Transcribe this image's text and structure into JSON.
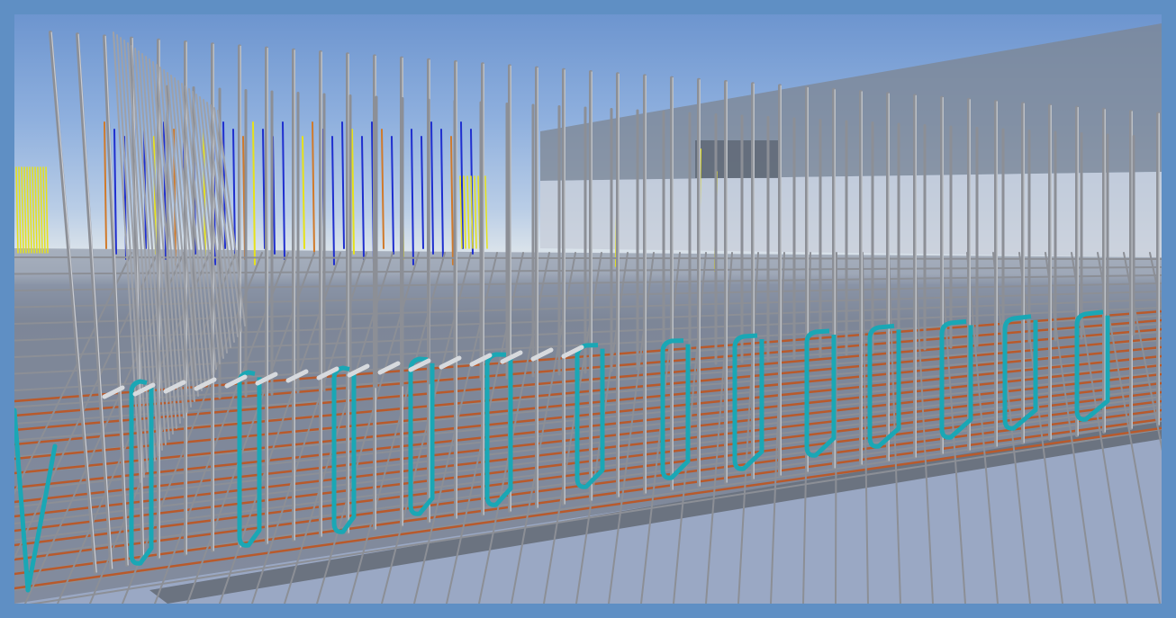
{
  "window": {
    "title": ""
  },
  "viewport": {
    "content": "3d-rebar-model",
    "colors": {
      "frame": "#5f8fc4",
      "sky_top": "#6d95cf",
      "rebar_gray": "#8c8f96",
      "rebar_light": "#c9ccd3",
      "stirrup_teal": "#1aa7b5",
      "bottom_bar_orange": "#b85a2c",
      "blue_bars": "#1f2fcf",
      "yellow_bars": "#e6e21a",
      "slab_edge": "#6e7683",
      "wall_gray": "#7d8591"
    }
  }
}
